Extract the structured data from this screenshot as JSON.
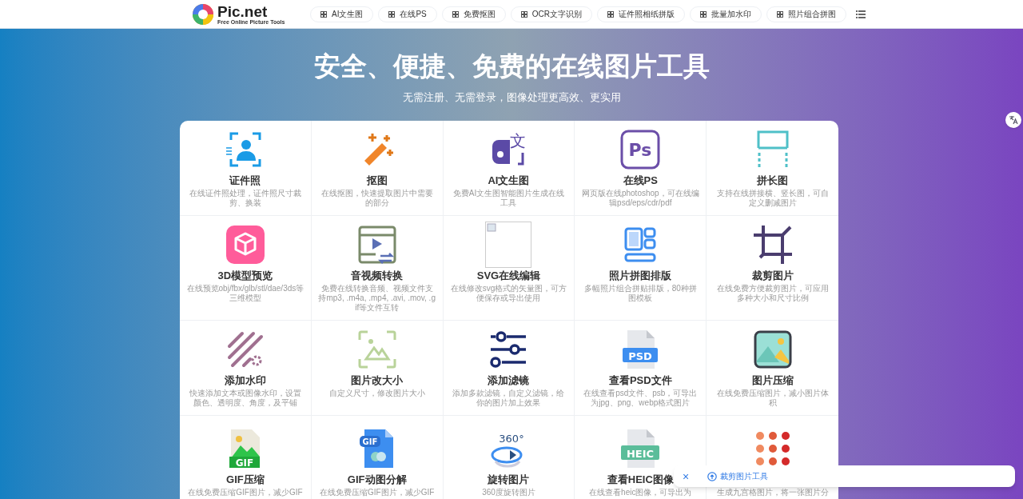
{
  "header": {
    "logo_text": "Pic.net",
    "logo_tagline": "Free Online Picture Tools",
    "nav": [
      "AI文生图",
      "在线PS",
      "免费抠图",
      "OCR文字识别",
      "证件照相纸拼版",
      "批量加水印",
      "照片组合拼图"
    ]
  },
  "hero": {
    "title": "安全、便捷、免费的在线图片工具",
    "subtitle": "无需注册、无需登录，图像处理更高效、更实用"
  },
  "tools": [
    {
      "title": "证件照",
      "description": "在线证件照处理，证件照尺寸裁剪、换装"
    },
    {
      "title": "抠图",
      "description": "在线抠图，快速提取图片中需要的部分"
    },
    {
      "title": "AI文生图",
      "description": "免费AI文生图智能图片生成在线工具",
      "icon_text": "文"
    },
    {
      "title": "在线PS",
      "description": "网页版在线photoshop，可在线编辑psd/eps/cdr/pdf",
      "icon_text": "Ps"
    },
    {
      "title": "拼长图",
      "description": "支持在线拼接横、竖长图，可自定义删减图片"
    },
    {
      "title": "3D模型预览",
      "description": "在线预览obj/fbx/glb/stl/dae/3ds等三维模型"
    },
    {
      "title": "音视频转换",
      "description": "免费在线转换音频、视频文件支持mp3, .m4a, .mp4, .avi, .mov, .gif等文件互转"
    },
    {
      "title": "SVG在线编辑",
      "description": "在线修改svg格式的矢量图，可方便保存或导出使用"
    },
    {
      "title": "照片拼图排版",
      "description": "多幅照片组合拼贴排版，80种拼图模板"
    },
    {
      "title": "裁剪图片",
      "description": "在线免费方便裁剪图片，可应用多种大小和尺寸比例"
    },
    {
      "title": "添加水印",
      "description": "快速添加文本或图像水印，设置颜色、透明度、角度，及平铺"
    },
    {
      "title": "图片改大小",
      "description": "自定义尺寸，修改图片大小"
    },
    {
      "title": "添加滤镜",
      "description": "添加多款滤镜，自定义滤镜，给你的图片加上效果"
    },
    {
      "title": "查看PSD文件",
      "description": "在线查看psd文件、psb，可导出为jpg、png、webp格式图片",
      "icon_text": "PSD"
    },
    {
      "title": "图片压缩",
      "description": "在线免费压缩图片，减小图片体积"
    },
    {
      "title": "GIF压缩",
      "description": "在线免费压缩GIF图片，减少GIF",
      "icon_text": "GIF"
    },
    {
      "title": "GIF动图分解",
      "description": "在线免费压缩GIF图片，减少GIF",
      "icon_text": "GIF"
    },
    {
      "title": "旋转图片",
      "description": "360度旋转图片",
      "icon_text": "360°"
    },
    {
      "title": "查看HEIC图像",
      "description": "在线查看heic图像，可导出为",
      "icon_text": "HEIC"
    },
    {
      "description": "生成九宫格图片，将一张图片分"
    }
  ],
  "toast": {
    "close": "×",
    "label": "裁剪图片工具"
  }
}
